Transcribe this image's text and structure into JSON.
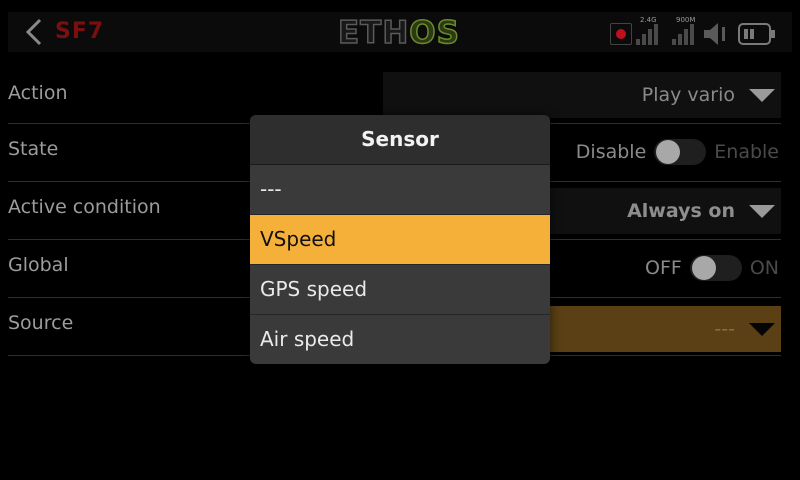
{
  "header": {
    "title": "SF7",
    "logo_left": "ETH",
    "logo_right": "OS",
    "signal1_label": "2.4G",
    "signal2_label": "900M"
  },
  "rows": [
    {
      "label": "Action",
      "value": "Play vario"
    },
    {
      "label": "State",
      "off_label": "Disable",
      "on_label": "Enable"
    },
    {
      "label": "Active condition",
      "value": "Always on"
    },
    {
      "label": "Global",
      "off_label": "OFF",
      "on_label": "ON"
    },
    {
      "label": "Source",
      "value": "---"
    }
  ],
  "popup": {
    "title": "Sensor",
    "options": [
      "---",
      "VSpeed",
      "GPS speed",
      "Air speed"
    ],
    "selected_index": 1
  },
  "colors": {
    "accent": "#f5b03a",
    "title_red": "#7a0f0f",
    "logo_green": "#6c8a2a"
  }
}
